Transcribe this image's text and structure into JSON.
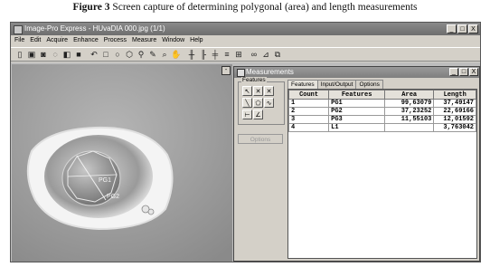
{
  "caption": {
    "label": "Figure 3",
    "text": "Screen capture of determining polygonal (area) and length measurements"
  },
  "app": {
    "title": "Image-Pro Express - HUvaDIA 000.jpg (1/1)",
    "window_controls": [
      "_",
      "□",
      "X"
    ],
    "menu": [
      "File",
      "Edit",
      "Acquire",
      "Enhance",
      "Process",
      "Measure",
      "Window",
      "Help"
    ],
    "toolbar_icons": [
      "new-icon",
      "save-icon",
      "camera-icon",
      "lasso-icon",
      "open-icon",
      "print-icon",
      "undo-icon",
      "rect-select-icon",
      "ellipse-select-icon",
      "polygon-select-icon",
      "wand-icon",
      "pen-icon",
      "zoom-icon",
      "hand-icon",
      "histogram-icon",
      "line-profile-icon",
      "bitmap-icon",
      "grid-icon",
      "measure-icon",
      "count-icon",
      "calibrate-icon",
      "ruler-icon"
    ]
  },
  "image_window": {
    "labels": [
      "PG1",
      "PG2"
    ]
  },
  "measurements": {
    "title": "Measurements",
    "features_label": "Features",
    "options_label": "Options",
    "tabs": [
      "Features",
      "Input/Output",
      "Options"
    ],
    "columns": [
      "Count",
      "Features",
      "Area",
      "Length"
    ],
    "rows": [
      {
        "count": "1",
        "feature": "PG1",
        "area": "99,63079",
        "length": "37,49147"
      },
      {
        "count": "2",
        "feature": "PG2",
        "area": "37,23252",
        "length": "22,69166"
      },
      {
        "count": "3",
        "feature": "PG3",
        "area": "11,55103",
        "length": "12,01592"
      },
      {
        "count": "4",
        "feature": "L1",
        "area": "",
        "length": "3,763042"
      }
    ]
  }
}
